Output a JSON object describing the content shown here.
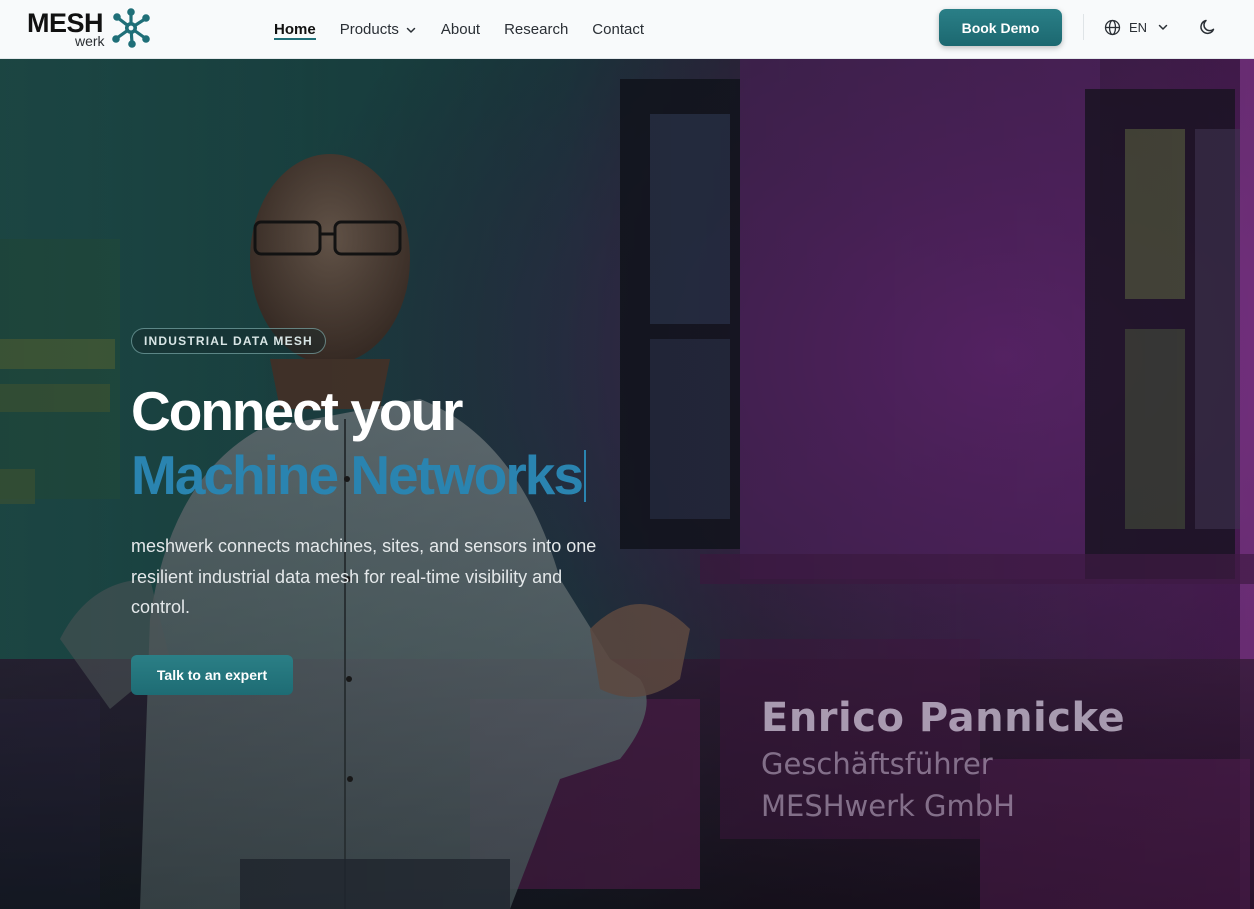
{
  "header": {
    "logo": {
      "mesh": "MESH",
      "werk": "werk"
    },
    "nav": [
      {
        "label": "Home"
      },
      {
        "label": "Products"
      },
      {
        "label": "About"
      },
      {
        "label": "Research"
      },
      {
        "label": "Contact"
      }
    ],
    "book_demo": "Book Demo",
    "language": "EN",
    "icons": {
      "language": "globe-icon",
      "theme": "moon-icon",
      "dropdown": "chevron-down-icon"
    }
  },
  "hero": {
    "badge": "INDUSTRIAL DATA MESH",
    "headline_line1": "Connect your",
    "headline_line2": "Machine Networks",
    "subtext": "meshwerk connects machines, sites, and sensors into one resilient industrial data mesh for real-time visibility and control.",
    "cta": "Talk to an expert",
    "caption": {
      "name": "Enrico Pannicke",
      "role": "Geschäftsführer",
      "company": "MESHwerk GmbH"
    }
  },
  "colors": {
    "accent": "#1f6f78",
    "headline_highlight": "#2a84b0",
    "header_bg": "#f8fafb"
  }
}
